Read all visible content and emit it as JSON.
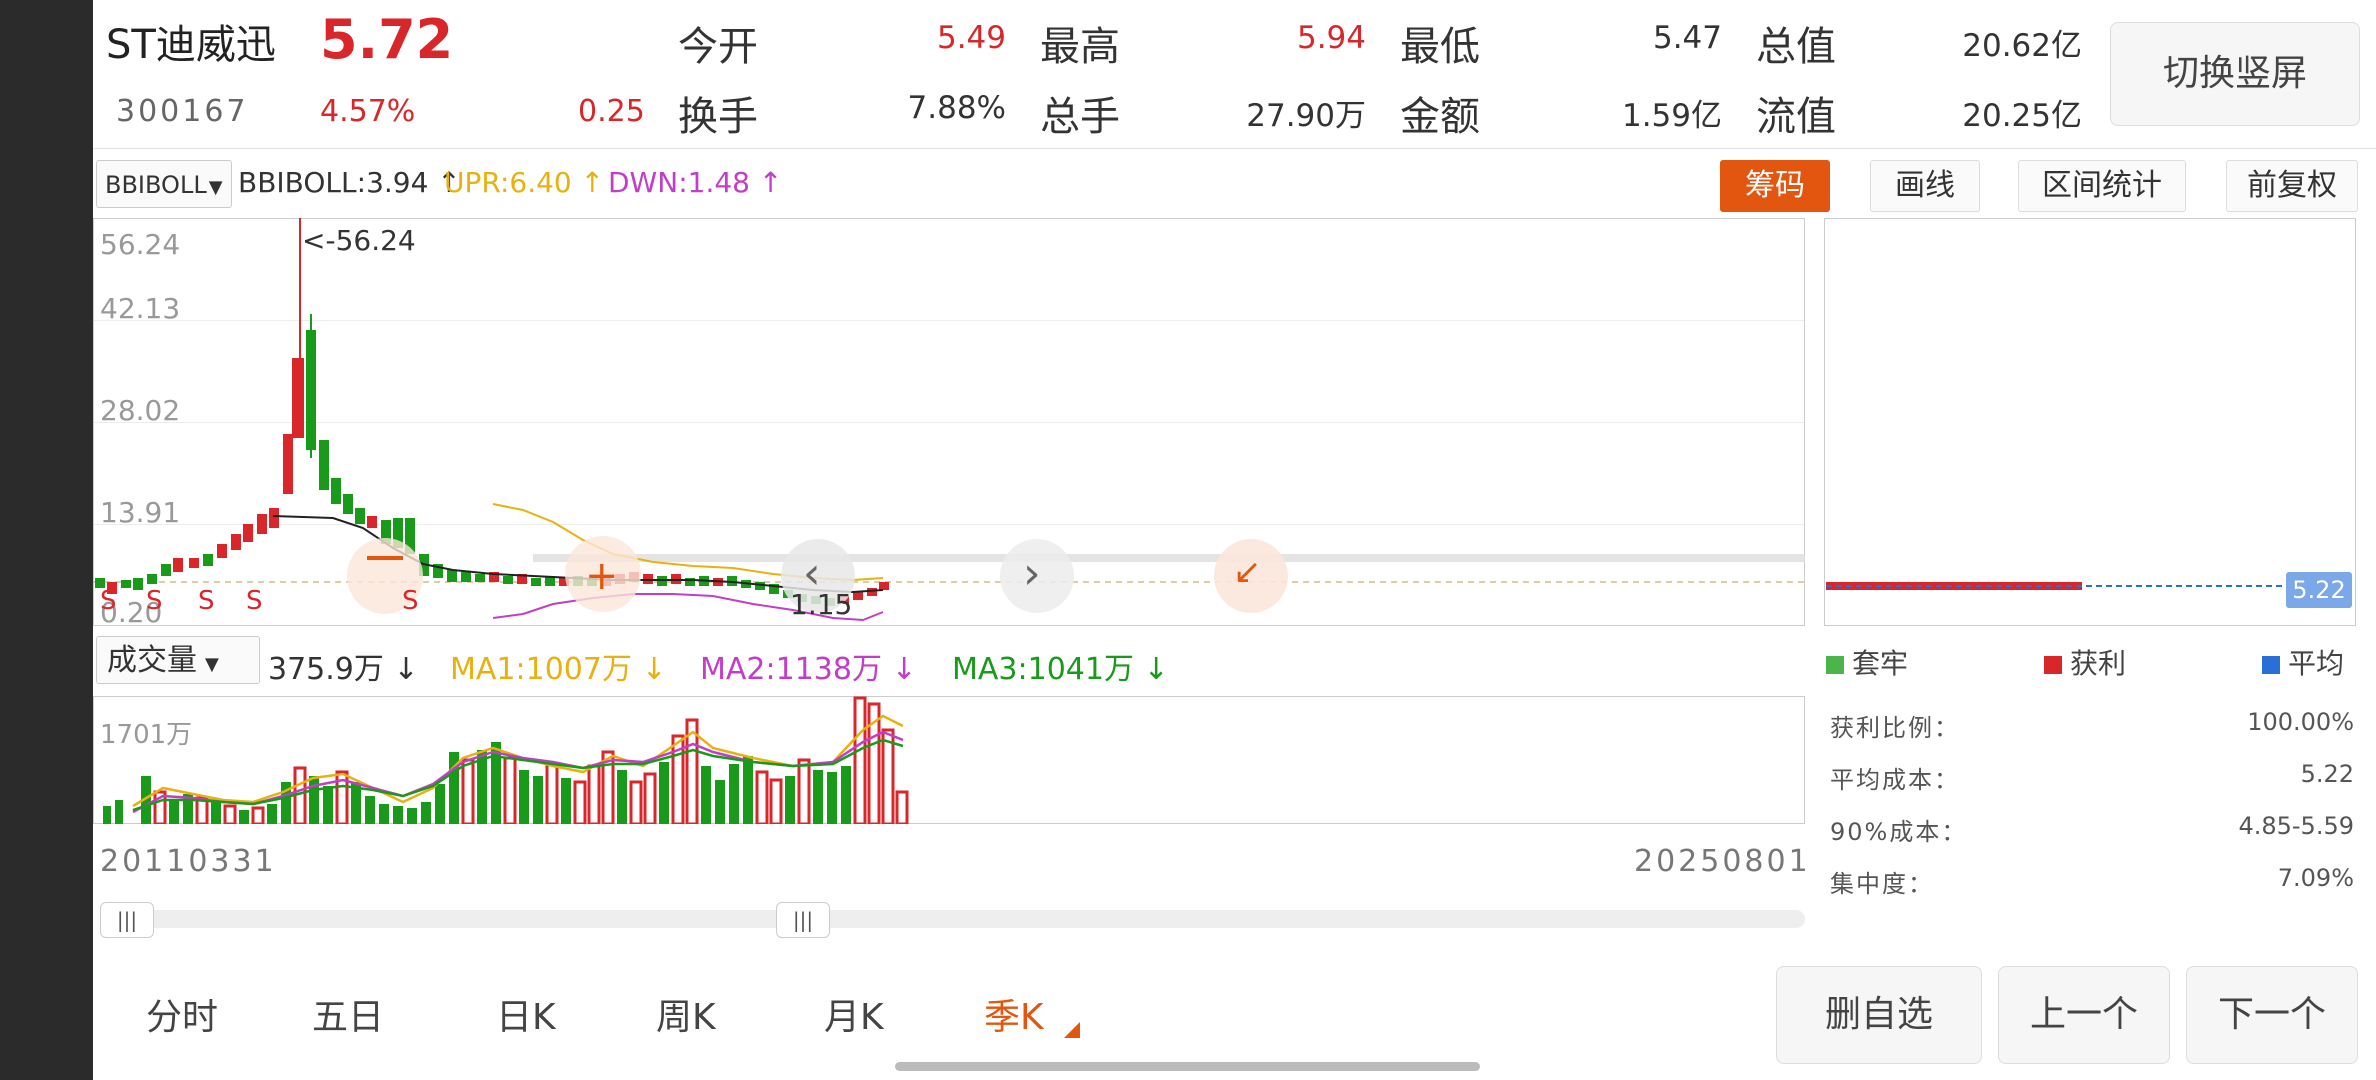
{
  "header": {
    "name": "ST迪威迅",
    "price": "5.72",
    "code": "300167",
    "change_pct": "4.57%",
    "change_amt": "0.25",
    "open_label": "今开",
    "open_value": "5.49",
    "high_label": "最高",
    "high_value": "5.94",
    "low_label": "最低",
    "low_value": "5.47",
    "mktcap_label": "总值",
    "mktcap_value": "20.62亿",
    "turnover_label": "换手",
    "turnover_value": "7.88%",
    "volume_label": "总手",
    "volume_value": "27.90万",
    "amount_label": "金额",
    "amount_value": "1.59亿",
    "float_label": "流值",
    "float_value": "20.25亿",
    "switch_button": "切换竖屏"
  },
  "indicator": {
    "selector": "BBIBOLL",
    "bbiboll": "BBIBOLL:3.94 ↑",
    "upr": "UPR:6.40 ↑",
    "dwn": "DWN:1.48 ↑"
  },
  "toolbar": {
    "chips": "筹码",
    "draw": "画线",
    "range_stats": "区间统计",
    "adjust": "前复权"
  },
  "price_chart": {
    "y_ticks": [
      "56.24",
      "42.13",
      "28.02",
      "13.91",
      "0.20"
    ],
    "max_marker": "<-56.24",
    "min_marker": "1.15",
    "signal_label": "S"
  },
  "volume": {
    "selector": "成交量",
    "value": "375.9万 ↓",
    "ma1": "MA1:1007万 ↓",
    "ma2": "MA2:1138万 ↓",
    "ma3": "MA3:1041万 ↓",
    "y_max": "1701万"
  },
  "dates": {
    "start": "20110331",
    "end": "20250801"
  },
  "periods": {
    "intraday": "分时",
    "five_day": "五日",
    "day_k": "日K",
    "week_k": "周K",
    "month_k": "月K",
    "quarter_k": "季K"
  },
  "buttons": {
    "remove_watch": "删自选",
    "prev": "上一个",
    "next": "下一个"
  },
  "chips_panel": {
    "avg_price_badge": "5.22",
    "legend_trapped": "套牢",
    "legend_profit": "获利",
    "legend_avg": "平均",
    "profit_ratio_label": "获利比例：",
    "profit_ratio_value": "100.00%",
    "avg_cost_label": "平均成本：",
    "avg_cost_value": "5.22",
    "cost90_label": "90%成本：",
    "cost90_value": "4.85-5.59",
    "concentration_label": "集中度：",
    "concentration_value": "7.09%"
  },
  "colors": {
    "up": "#d9262b",
    "down": "#1a9a1a",
    "accent": "#e2560f",
    "ma1": "#e8b10f",
    "ma2": "#c23ec9",
    "ma3": "#1a9a1a",
    "avg": "#2a6fd6"
  }
}
